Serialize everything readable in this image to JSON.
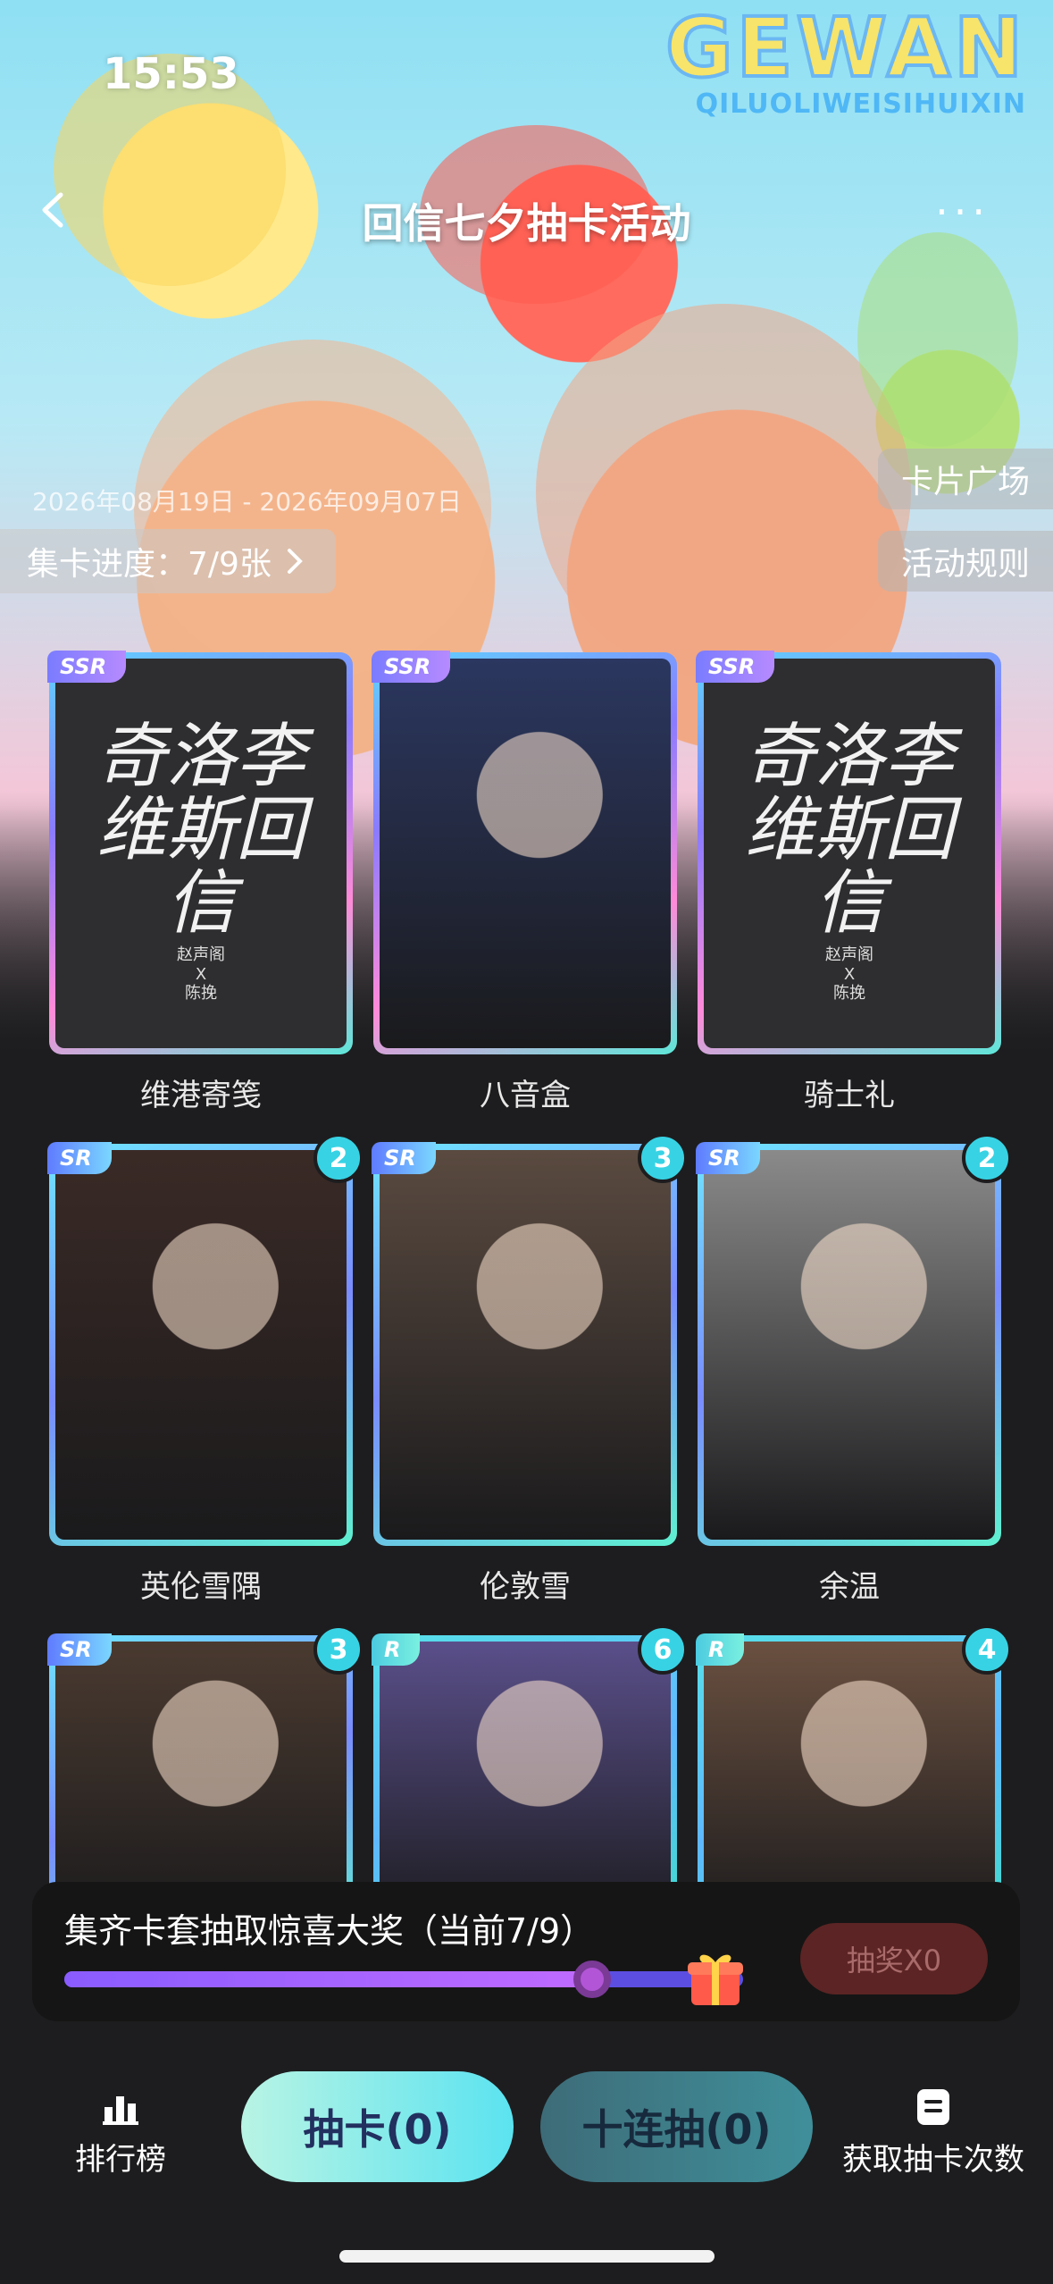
{
  "status": {
    "time": "15:53"
  },
  "brand": {
    "logo": "GEWAN",
    "subtitle": "QILUOLIWEISIHUIXIN"
  },
  "nav": {
    "title": "回信七夕抽卡活动",
    "more": "···"
  },
  "event": {
    "date_range": "2026年08月19日 - 2026年09月07日",
    "progress_label": "集卡进度：7/9张",
    "card_square": "卡片广场",
    "rules": "活动规则"
  },
  "cards": [
    {
      "rarity": "SSR",
      "name": "维港寄笺",
      "count": null,
      "cover": "calligraphy",
      "calli": "奇洛李维斯回信",
      "credit": "赵声阁\nX\n陈挽"
    },
    {
      "rarity": "SSR",
      "name": "八音盒",
      "count": null,
      "cover": "art",
      "color": "#2b3760"
    },
    {
      "rarity": "SSR",
      "name": "骑士礼",
      "count": null,
      "cover": "calligraphy",
      "calli": "奇洛李维斯回信",
      "credit": "赵声阁\nX\n陈挽"
    },
    {
      "rarity": "SR",
      "name": "英伦雪隅",
      "count": "2",
      "cover": "art",
      "color": "#3a2a26"
    },
    {
      "rarity": "SR",
      "name": "伦敦雪",
      "count": "3",
      "cover": "art",
      "color": "#5a4a40"
    },
    {
      "rarity": "SR",
      "name": "余温",
      "count": "2",
      "cover": "art",
      "color": "#8a8a8a"
    },
    {
      "rarity": "SR",
      "name": "",
      "count": "3",
      "cover": "art",
      "color": "#4a3a30"
    },
    {
      "rarity": "R",
      "name": "",
      "count": "6",
      "cover": "art",
      "color": "#5a4f8a"
    },
    {
      "rarity": "R",
      "name": "",
      "count": "4",
      "cover": "art",
      "color": "#6a5040"
    }
  ],
  "lottery": {
    "text": "集齐卡套抽取惊喜大奖（当前7/9）",
    "progress": 0.778,
    "button": "抽奖X0"
  },
  "bottom": {
    "ranking": "排行榜",
    "draw_one": "抽卡(0)",
    "draw_ten": "十连抽(0)",
    "get_chances": "获取抽卡次数"
  },
  "colors": {
    "background": "#1d1d1f",
    "pill_one": "#5be3f0",
    "pill_ten": "#3f8f9a",
    "badge": "#37d3e4"
  },
  "icons": [
    "back-icon",
    "more-icon",
    "chevron-right-icon",
    "gift-icon",
    "ranking-icon",
    "document-icon"
  ]
}
